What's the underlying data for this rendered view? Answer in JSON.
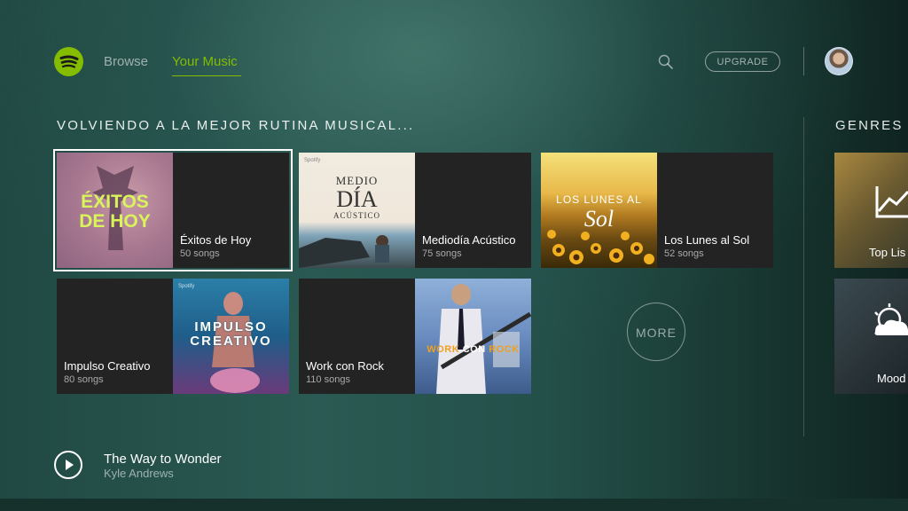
{
  "nav": {
    "browse": "Browse",
    "your_music": "Your Music",
    "upgrade": "UPGRADE",
    "search_icon": "search-icon",
    "logo_icon": "spotify-logo-icon"
  },
  "main": {
    "section_title": "VOLVIENDO A LA MEJOR RUTINA MUSICAL...",
    "playlists": [
      {
        "title": "Éxitos de Hoy",
        "count": "50 songs",
        "art_text": "ÉXITOS DE HOY"
      },
      {
        "title": "Mediodía Acústico",
        "count": "75 songs",
        "art_text_1": "MEDIO",
        "art_text_2": "DÍA",
        "art_text_3": "ACÚSTICO",
        "art_tag": "Spotify"
      },
      {
        "title": "Los Lunes al Sol",
        "count": "52 songs",
        "art_text_1": "LOS LUNES AL",
        "art_text_2": "Sol"
      },
      {
        "title": "Impulso Creativo",
        "count": "80 songs",
        "art_text_1": "IMPULSO",
        "art_text_2": "CREATIVO",
        "art_tag": "Spotify"
      },
      {
        "title": "Work con Rock",
        "count": "110 songs",
        "art_text_1": "WORK",
        "art_text_2": "CON",
        "art_text_3": "ROCK"
      }
    ],
    "more": "MORE"
  },
  "genres": {
    "section_title": "GENRES &",
    "items": [
      {
        "label": "Top Lis"
      },
      {
        "label": "Mood"
      }
    ]
  },
  "now_playing": {
    "track": "The Way to Wonder",
    "artist": "Kyle Andrews"
  },
  "colors": {
    "accent": "#84bd00",
    "card_bg": "#232323"
  }
}
